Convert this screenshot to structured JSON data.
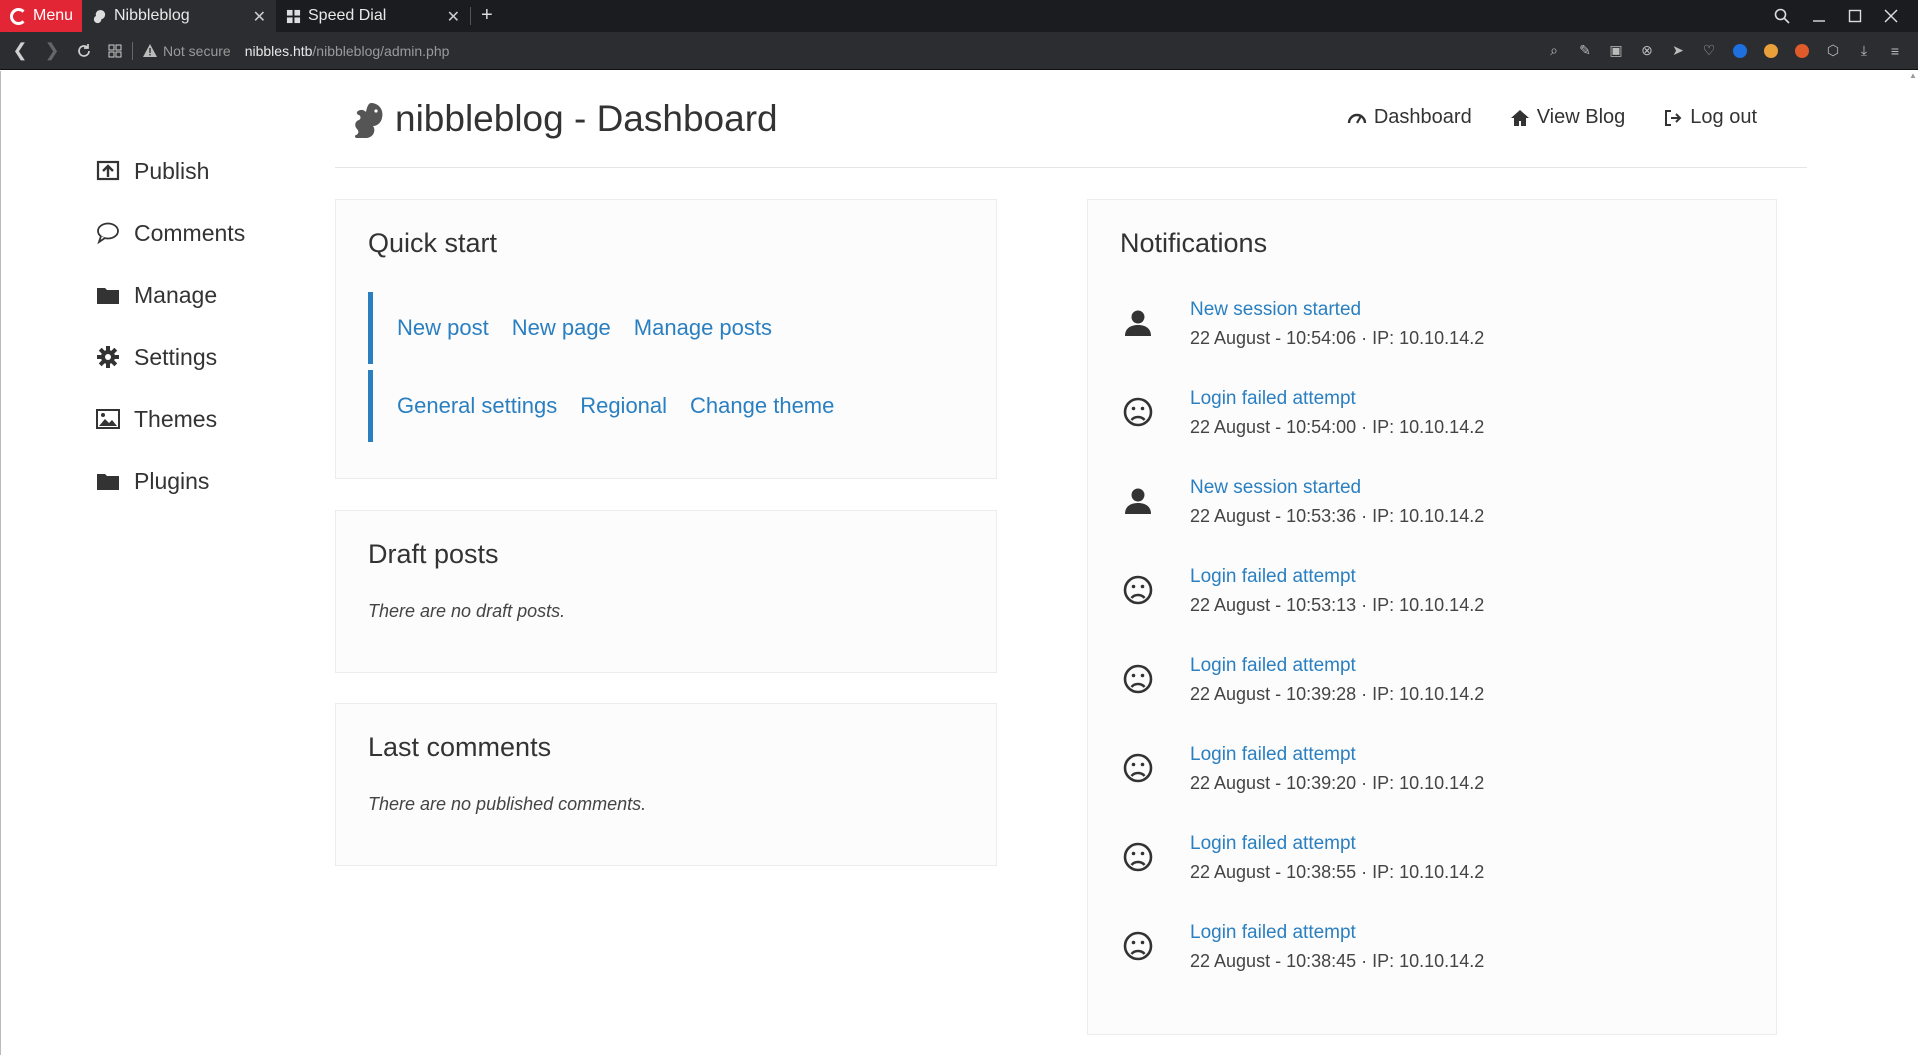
{
  "browser": {
    "menu_label": "Menu",
    "tabs": [
      {
        "title": "Nibbleblog",
        "close": "✕"
      },
      {
        "title": "Speed Dial",
        "close": "✕"
      }
    ],
    "new_tab": "+",
    "security_label": "Not secure",
    "url_host": "nibbles.htb",
    "url_path": "/nibbleblog/admin.php"
  },
  "header": {
    "title": "nibbleblog - Dashboard",
    "nav": [
      "Dashboard",
      "View Blog",
      "Log out"
    ]
  },
  "sidebar": {
    "items": [
      {
        "label": "Publish",
        "icon": "publish-icon"
      },
      {
        "label": "Comments",
        "icon": "comment-icon"
      },
      {
        "label": "Manage",
        "icon": "folder-icon"
      },
      {
        "label": "Settings",
        "icon": "gear-icon"
      },
      {
        "label": "Themes",
        "icon": "image-icon"
      },
      {
        "label": "Plugins",
        "icon": "folder-icon"
      }
    ]
  },
  "quick_start": {
    "title": "Quick start",
    "row1": [
      "New post",
      "New page",
      "Manage posts"
    ],
    "row2": [
      "General settings",
      "Regional",
      "Change theme"
    ]
  },
  "draft_posts": {
    "title": "Draft posts",
    "empty": "There are no draft posts."
  },
  "last_comments": {
    "title": "Last comments",
    "empty": "There are no published comments."
  },
  "notifications": {
    "title": "Notifications",
    "items": [
      {
        "type": "session",
        "icon": "user-icon",
        "title": "New session started",
        "meta": "22 August - 10:54:06 · IP: 10.10.14.2"
      },
      {
        "type": "fail",
        "icon": "frown-icon",
        "title": "Login failed attempt",
        "meta": "22 August - 10:54:00 · IP: 10.10.14.2"
      },
      {
        "type": "session",
        "icon": "user-icon",
        "title": "New session started",
        "meta": "22 August - 10:53:36 · IP: 10.10.14.2"
      },
      {
        "type": "fail",
        "icon": "frown-icon",
        "title": "Login failed attempt",
        "meta": "22 August - 10:53:13 · IP: 10.10.14.2"
      },
      {
        "type": "fail",
        "icon": "frown-icon",
        "title": "Login failed attempt",
        "meta": "22 August - 10:39:28 · IP: 10.10.14.2"
      },
      {
        "type": "fail",
        "icon": "frown-icon",
        "title": "Login failed attempt",
        "meta": "22 August - 10:39:20 · IP: 10.10.14.2"
      },
      {
        "type": "fail",
        "icon": "frown-icon",
        "title": "Login failed attempt",
        "meta": "22 August - 10:38:55 · IP: 10.10.14.2"
      },
      {
        "type": "fail",
        "icon": "frown-icon",
        "title": "Login failed attempt",
        "meta": "22 August - 10:38:45 · IP: 10.10.14.2"
      }
    ]
  },
  "colors": {
    "accent": "#2a7fc1",
    "menu": "#e32636"
  }
}
